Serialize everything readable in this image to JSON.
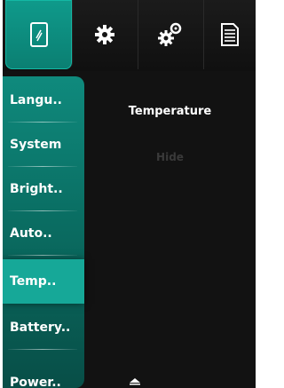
{
  "tabs": [
    {
      "icon": "phone-icon",
      "active": true
    },
    {
      "icon": "gear-icon",
      "active": false
    },
    {
      "icon": "gears-icon",
      "active": false
    },
    {
      "icon": "document-icon",
      "active": false
    }
  ],
  "sidebar": {
    "items": [
      {
        "label": "Langu.."
      },
      {
        "label": "System"
      },
      {
        "label": "Bright.."
      },
      {
        "label": "Auto.."
      },
      {
        "label": "Temp.."
      },
      {
        "label": "Battery.."
      },
      {
        "label": "Power.."
      }
    ],
    "active_index": 4
  },
  "content": {
    "title": "Temperature",
    "value": "Hide"
  },
  "scroll": {
    "icon": "chevron-up-icon"
  },
  "colors": {
    "accent": "#0f9a8b",
    "active_item": "#16a898",
    "background": "#121212"
  }
}
